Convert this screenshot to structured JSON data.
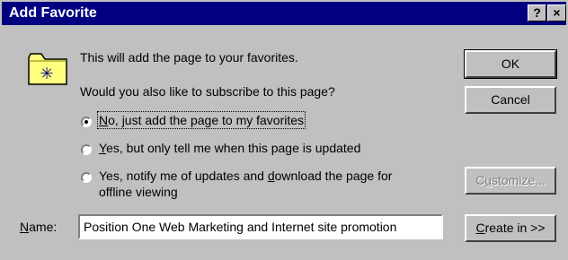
{
  "dialog": {
    "title": "Add Favorite",
    "help_label": "?",
    "close_label": "×"
  },
  "message": {
    "line1": "This will add the page to your favorites.",
    "line2": "Would you also like to subscribe to this page?"
  },
  "options": [
    {
      "label": "No, just add the page to my favorites",
      "mnemonic": "N",
      "rest": "o, just add the page to my favorites",
      "selected": true
    },
    {
      "label": "Yes, but only tell me when this page is updated",
      "mnemonic": "Y",
      "rest": "es, but only tell me when this page is updated",
      "selected": false
    },
    {
      "label_pre": "Yes, notify me of updates and ",
      "mnemonic": "d",
      "label_post": "ownload the page for",
      "label_line2": "offline viewing",
      "selected": false
    }
  ],
  "name_field": {
    "label_mnemonic": "N",
    "label_rest": "ame:",
    "value": "Position One Web Marketing and Internet site promotion"
  },
  "buttons": {
    "ok": "OK",
    "cancel": "Cancel",
    "customize_pre": "C",
    "customize_mnemonic": "u",
    "customize_post": "stomize...",
    "create_mnemonic": "C",
    "create_rest": "reate in >>"
  },
  "colors": {
    "titlebar": "#000080",
    "face": "#c0c0c0",
    "folder": "#ffff80"
  },
  "icons": {
    "folder": "folder-star-icon"
  }
}
